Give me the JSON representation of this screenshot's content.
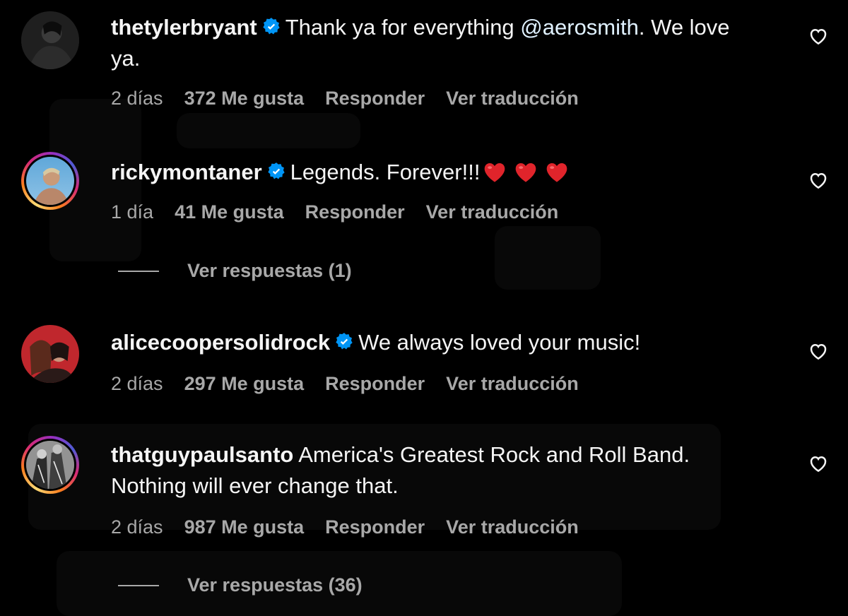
{
  "comments": [
    {
      "username": "thetylerbryant",
      "verified": true,
      "text_before": "Thank ya for everything ",
      "mention": "@aerosmith",
      "text_after": ". We love ya.",
      "time": "2 días",
      "likes": "372 Me gusta",
      "reply": "Responder",
      "translate": "Ver traducción",
      "avatar_icon": "profile-photo"
    },
    {
      "username": "rickymontaner",
      "verified": true,
      "text": "Legends. Forever!!!",
      "emoji": [
        "red-heart",
        "red-heart",
        "red-heart"
      ],
      "time": "1 día",
      "likes": "41 Me gusta",
      "reply": "Responder",
      "translate": "Ver traducción",
      "view_replies": "Ver respuestas (1)",
      "avatar_icon": "profile-photo"
    },
    {
      "username": "alicecoopersolidrock",
      "verified": true,
      "text": "We always loved your music!",
      "time": "2 días",
      "likes": "297 Me gusta",
      "reply": "Responder",
      "translate": "Ver traducción",
      "avatar_icon": "profile-photo"
    },
    {
      "username": "thatguypaulsanto",
      "verified": false,
      "text": "America's Greatest Rock and Roll Band. Nothing will ever change that.",
      "time": "2 días",
      "likes": "987 Me gusta",
      "reply": "Responder",
      "translate": "Ver traducción",
      "view_replies": "Ver respuestas (36)",
      "avatar_icon": "profile-photo"
    }
  ],
  "icons": {
    "like": "heart-outline-icon",
    "verified": "verified-badge-icon"
  },
  "colors": {
    "background": "#000000",
    "text": "#f5f5f5",
    "secondary_text": "#a8a8a8",
    "verified_blue": "#0095f6",
    "heart_red": "#e0242b"
  }
}
